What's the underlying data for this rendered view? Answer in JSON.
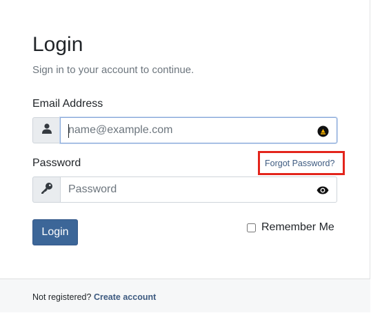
{
  "form": {
    "title": "Login",
    "subtitle": "Sign in to your account to continue.",
    "email_label": "Email Address",
    "email_placeholder": "name@example.com",
    "email_value": "",
    "password_label": "Password",
    "password_placeholder": "Password",
    "password_value": "",
    "forgot_password": "Forgot Password?",
    "login_button": "Login",
    "remember_me": "Remember Me",
    "remember_checked": false
  },
  "footer": {
    "text": "Not registered?",
    "link": "Create account"
  },
  "icons": {
    "email_addon": "user-icon",
    "email_autofill": "autofill-icon",
    "password_addon": "key-icon",
    "password_toggle": "eye-icon"
  },
  "colors": {
    "primary": "#3c6698",
    "link": "#3d5a80",
    "highlight": "#e3241b",
    "muted": "#6c757d",
    "addon_bg": "#e9ecef",
    "footer_bg": "#f6f7f8"
  }
}
